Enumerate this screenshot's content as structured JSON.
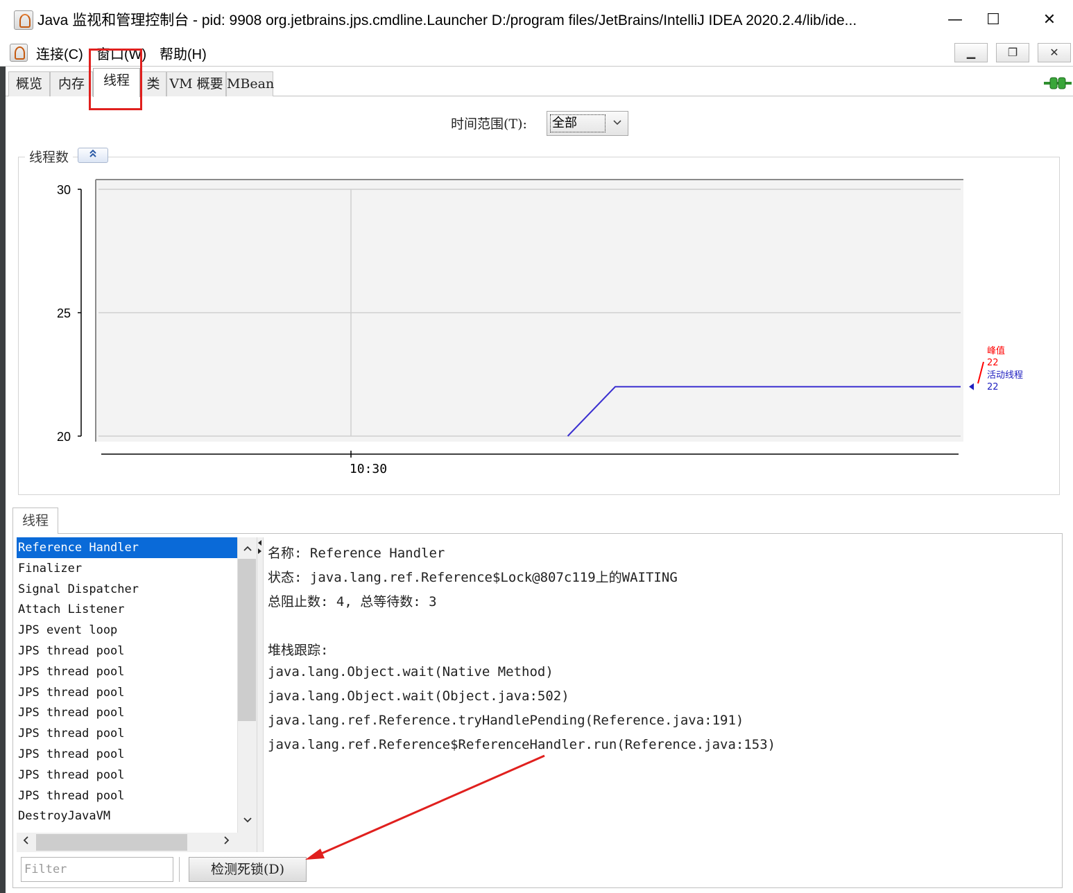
{
  "window": {
    "title": "Java 监视和管理控制台 - pid: 9908 org.jetbrains.jps.cmdline.Launcher D:/program files/JetBrains/IntelliJ IDEA 2020.2.4/lib/ide...",
    "controls": {
      "minimize": "—",
      "maximize": "☐",
      "close": "✕"
    }
  },
  "menubar": {
    "items": [
      "连接(C)",
      "窗口(W)",
      "帮助(H)"
    ],
    "mdi_buttons": [
      "▁",
      "❐",
      "✕"
    ]
  },
  "tabs": [
    {
      "label": "概览",
      "active": false
    },
    {
      "label": "内存",
      "active": false
    },
    {
      "label": "线程",
      "active": true
    },
    {
      "label": "类",
      "active": false
    },
    {
      "label": "VM 概要",
      "active": false
    },
    {
      "label": "MBean",
      "active": false
    }
  ],
  "time_range": {
    "label": "时间范围(T):",
    "value": "全部"
  },
  "chart_panel": {
    "title": "线程数",
    "collapse_icon": "double-chevron-up"
  },
  "chart_data": {
    "type": "line",
    "ylim": [
      20,
      30
    ],
    "yticks": [
      "30",
      "25",
      "20"
    ],
    "xtick_labels": [
      "10:30"
    ],
    "series": [
      {
        "name": "活动线程",
        "color": "#3a2fd0",
        "x": [
          0.545,
          0.6,
          1.0
        ],
        "values": [
          20,
          22,
          22
        ]
      }
    ],
    "peak": {
      "label": "峰值",
      "value": "22",
      "color": "#ff0000"
    },
    "live": {
      "label": "活动线程",
      "value": "22",
      "color": "#2020c0"
    }
  },
  "threads_section": {
    "tab_label": "线程",
    "list": [
      "Reference Handler",
      "Finalizer",
      "Signal Dispatcher",
      "Attach Listener",
      "JPS event loop",
      "JPS thread pool",
      "JPS thread pool",
      "JPS thread pool",
      "JPS thread pool",
      "JPS thread pool",
      "JPS thread pool",
      "JPS thread pool",
      "JPS thread pool",
      "DestroyJavaVM"
    ],
    "selected_index": 0,
    "details": {
      "name_line": "名称: Reference Handler",
      "state_line": "状态: java.lang.ref.Reference$Lock@807c119上的WAITING",
      "counts_line": "总阻止数: 4, 总等待数: 3",
      "stack_title": "堆栈跟踪:",
      "stack": [
        "java.lang.Object.wait(Native Method)",
        "java.lang.Object.wait(Object.java:502)",
        "java.lang.ref.Reference.tryHandlePending(Reference.java:191)",
        "java.lang.ref.Reference$ReferenceHandler.run(Reference.java:153)"
      ]
    },
    "filter_placeholder": "Filter",
    "detect_button": "检测死锁(D)"
  },
  "scroll": {
    "up": "^",
    "down": "v",
    "left": "<",
    "right": ">"
  },
  "colors": {
    "selection": "#0a6ad8",
    "annotation": "#e0201e"
  }
}
